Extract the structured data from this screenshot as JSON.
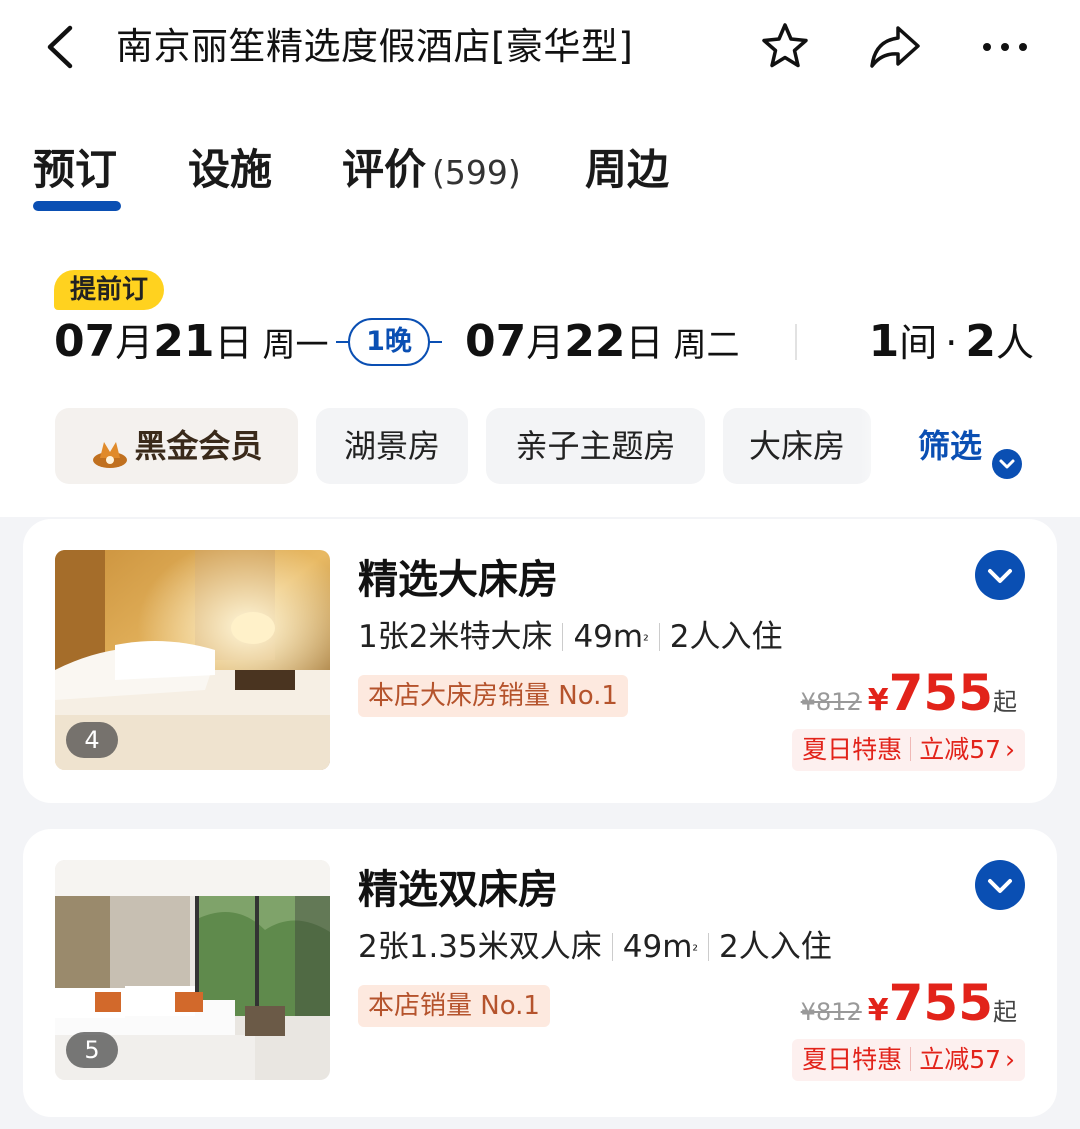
{
  "header": {
    "title": "南京丽笙精选度假酒店[豪华型]",
    "icons": [
      "back-icon",
      "star-icon",
      "share-icon",
      "more-icon"
    ]
  },
  "tabs": [
    {
      "label": "预订"
    },
    {
      "label": "设施"
    },
    {
      "label": "评价",
      "count": "(599)"
    },
    {
      "label": "周边"
    }
  ],
  "booking": {
    "badge": "提前订",
    "checkin": {
      "month": "07",
      "month_unit": "月",
      "day": "21",
      "day_unit": "日",
      "weekday": "周一"
    },
    "nights": "1晚",
    "checkout": {
      "month": "07",
      "month_unit": "月",
      "day": "22",
      "day_unit": "日",
      "weekday": "周二"
    },
    "rooms_num": "1",
    "rooms_unit": "间",
    "dot": "·",
    "guests_num": "2",
    "guests_unit": "人"
  },
  "filters": {
    "vip": "黑金会员",
    "chips": [
      "湖景房",
      "亲子主题房",
      "大床房"
    ],
    "filter_label": "筛选"
  },
  "rooms": [
    {
      "name": "精选大床房",
      "bed": "1张2米特大床",
      "area": "49m",
      "area_sup": "²",
      "occupancy": "2人入住",
      "badge": "本店大床房销量 No.1",
      "photo_count": "4",
      "orig_price": "¥812",
      "currency": "¥",
      "price": "755",
      "price_suffix": "起",
      "promo_name": "夏日特惠",
      "promo_discount": "立减57",
      "promo_arrow": "›"
    },
    {
      "name": "精选双床房",
      "bed": "2张1.35米双人床",
      "area": "49m",
      "area_sup": "²",
      "occupancy": "2人入住",
      "badge": "本店销量 No.1",
      "photo_count": "5",
      "orig_price": "¥812",
      "currency": "¥",
      "price": "755",
      "price_suffix": "起",
      "promo_name": "夏日特惠",
      "promo_discount": "立减57",
      "promo_arrow": "›"
    }
  ],
  "colors": {
    "accent": "#0a4fb3",
    "price": "#e2231a",
    "badge_yellow": "#ffd21f",
    "list_bg": "#f3f4f7"
  }
}
